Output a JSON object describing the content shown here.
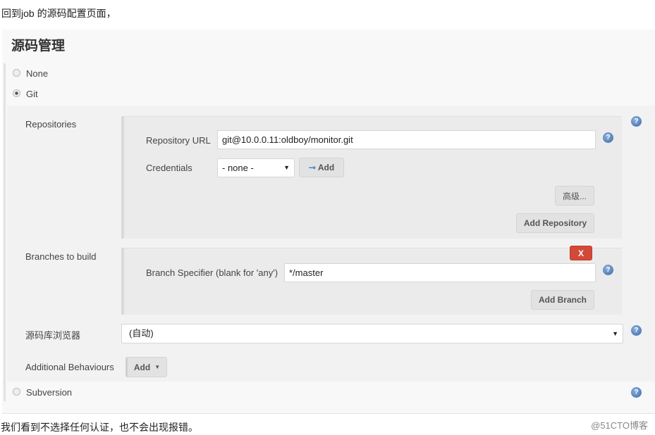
{
  "intro_text": "回到job 的源码配置页面，",
  "section_title": "源码管理",
  "scm_options": [
    {
      "label": "None",
      "selected": false
    },
    {
      "label": "Git",
      "selected": true
    },
    {
      "label": "Subversion",
      "selected": false
    }
  ],
  "repositories": {
    "label": "Repositories",
    "url_label": "Repository URL",
    "url_value": "git@10.0.0.11:oldboy/monitor.git",
    "credentials_label": "Credentials",
    "credentials_value": "- none -",
    "add_label": "Add",
    "advanced_label": "高级...",
    "add_repository_label": "Add Repository"
  },
  "branches": {
    "label": "Branches to build",
    "delete_label": "X",
    "specifier_label": "Branch Specifier (blank for 'any')",
    "specifier_value": "*/master",
    "add_branch_label": "Add Branch"
  },
  "browser": {
    "label": "源码库浏览器",
    "value": "(自动)"
  },
  "behaviours": {
    "label": "Additional Behaviours",
    "add_label": "Add"
  },
  "help_glyph": "?",
  "footer_text": "我们看到不选择任何认证，也不会出现报错。",
  "watermark": "@51CTO博客",
  "colors": {
    "delete": "#d24939",
    "help": "#3a66a6"
  }
}
